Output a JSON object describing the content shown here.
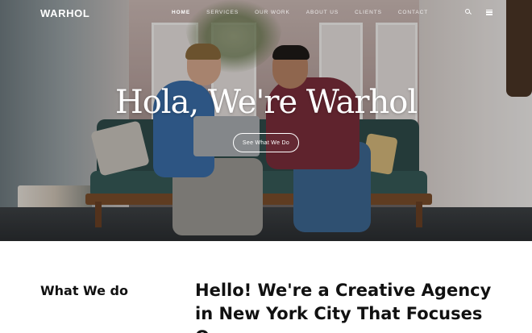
{
  "header": {
    "logo": "WARHOL",
    "nav": [
      {
        "label": "HOME",
        "active": true
      },
      {
        "label": "SERVICES",
        "active": false
      },
      {
        "label": "OUR WORK",
        "active": false
      },
      {
        "label": "ABOUT US",
        "active": false
      },
      {
        "label": "CLIENTS",
        "active": false
      },
      {
        "label": "CONTACT",
        "active": false
      }
    ],
    "icons": [
      "search-icon",
      "menu-icon"
    ]
  },
  "hero": {
    "title": "Hola, We're Warhol",
    "button_label": "See What We Do"
  },
  "section": {
    "heading": "What We do",
    "intro_text": "Hello! We're a Creative Agency in New York City That Focuses On"
  }
}
